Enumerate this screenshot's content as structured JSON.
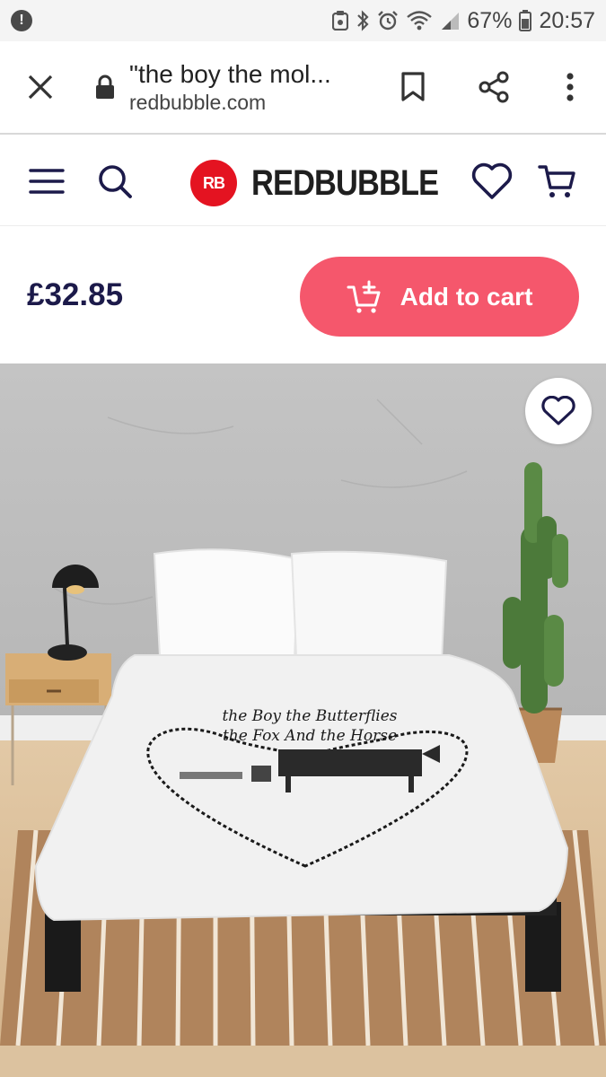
{
  "status_bar": {
    "alert_icon": "!",
    "icons": [
      "notification-icon",
      "bluetooth-icon",
      "alarm-icon",
      "wifi-icon",
      "signal-icon"
    ],
    "battery": "67%",
    "time": "20:57"
  },
  "browser": {
    "page_title": "\"the boy the mol...",
    "domain": "redbubble.com",
    "icons": [
      "close-icon",
      "lock-icon",
      "bookmark-icon",
      "share-icon",
      "more-vert-icon"
    ]
  },
  "header": {
    "logo_badge": "RB",
    "logo_text": "REDBUBBLE",
    "icons": [
      "menu-icon",
      "search-icon",
      "heart-icon",
      "cart-icon"
    ]
  },
  "product": {
    "price": "£32.85",
    "add_to_cart_label": "Add to cart",
    "accent_color": "#f5576c",
    "price_color": "#1c1a4a",
    "brand_color": "#e41321"
  }
}
